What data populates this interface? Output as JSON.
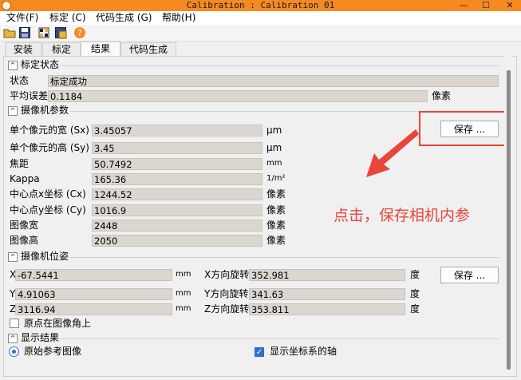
{
  "window": {
    "title": "Calibration : Calibration 01",
    "minimize": "—",
    "maximize": "☐",
    "close": "✕"
  },
  "menu": [
    "文件(F)",
    "标定 (C)",
    "代码生成 (G)",
    "帮助(H)"
  ],
  "tabs": [
    "安装",
    "标定",
    "结果",
    "代码生成"
  ],
  "active_tab": "结果",
  "calib_status": {
    "title": "标定状态",
    "status_label": "状态",
    "status_value": "标定成功",
    "error_label": "平均误差",
    "error_value": "0.1184",
    "error_unit": "像素"
  },
  "camera_params": {
    "title": "摄像机参数",
    "save_label": "保存 ...",
    "rows": [
      {
        "label": "单个像元的宽 (Sx)",
        "value": "3.45057",
        "unit": "μm"
      },
      {
        "label": "单个像元的高 (Sy)",
        "value": "3.45",
        "unit": "μm"
      },
      {
        "label": "焦距",
        "value": "50.7492",
        "unit": "mm"
      },
      {
        "label": "Kappa",
        "value": "165.36",
        "unit": "1/m²"
      },
      {
        "label": "中心点x坐标 (Cx)",
        "value": "1244.52",
        "unit": "像素"
      },
      {
        "label": "中心点y坐标 (Cy)",
        "value": "1016.9",
        "unit": "像素"
      },
      {
        "label": "图像宽",
        "value": "2448",
        "unit": "像素"
      },
      {
        "label": "图像高",
        "value": "2050",
        "unit": "像素"
      }
    ]
  },
  "camera_pose": {
    "title": "摄像机位姿",
    "save_label": "保存 ...",
    "rows": [
      {
        "axis": "X",
        "value": "-67.5441",
        "unit": "mm",
        "rot_label": "X方向旋转",
        "rot_value": "352.981",
        "rot_unit": "度"
      },
      {
        "axis": "Y",
        "value": "4.91063",
        "unit": "mm",
        "rot_label": "Y方向旋转",
        "rot_value": "341.63",
        "rot_unit": "度"
      },
      {
        "axis": "Z",
        "value": "3116.94",
        "unit": "mm",
        "rot_label": "Z方向旋转",
        "rot_value": "353.811",
        "rot_unit": "度"
      }
    ],
    "origin_corner_label": "原点在图像角上"
  },
  "display_results": {
    "title": "显示结果",
    "ref_image_label": "原始参考图像",
    "show_axes_label": "显示坐标系的轴"
  },
  "annotation": {
    "text": "点击，保存相机内参",
    "color": "#e8453c"
  },
  "colors": {
    "titlebar": "#f58a22",
    "field_bg": "#dcd6d0",
    "accent": "#2a6fd6"
  }
}
